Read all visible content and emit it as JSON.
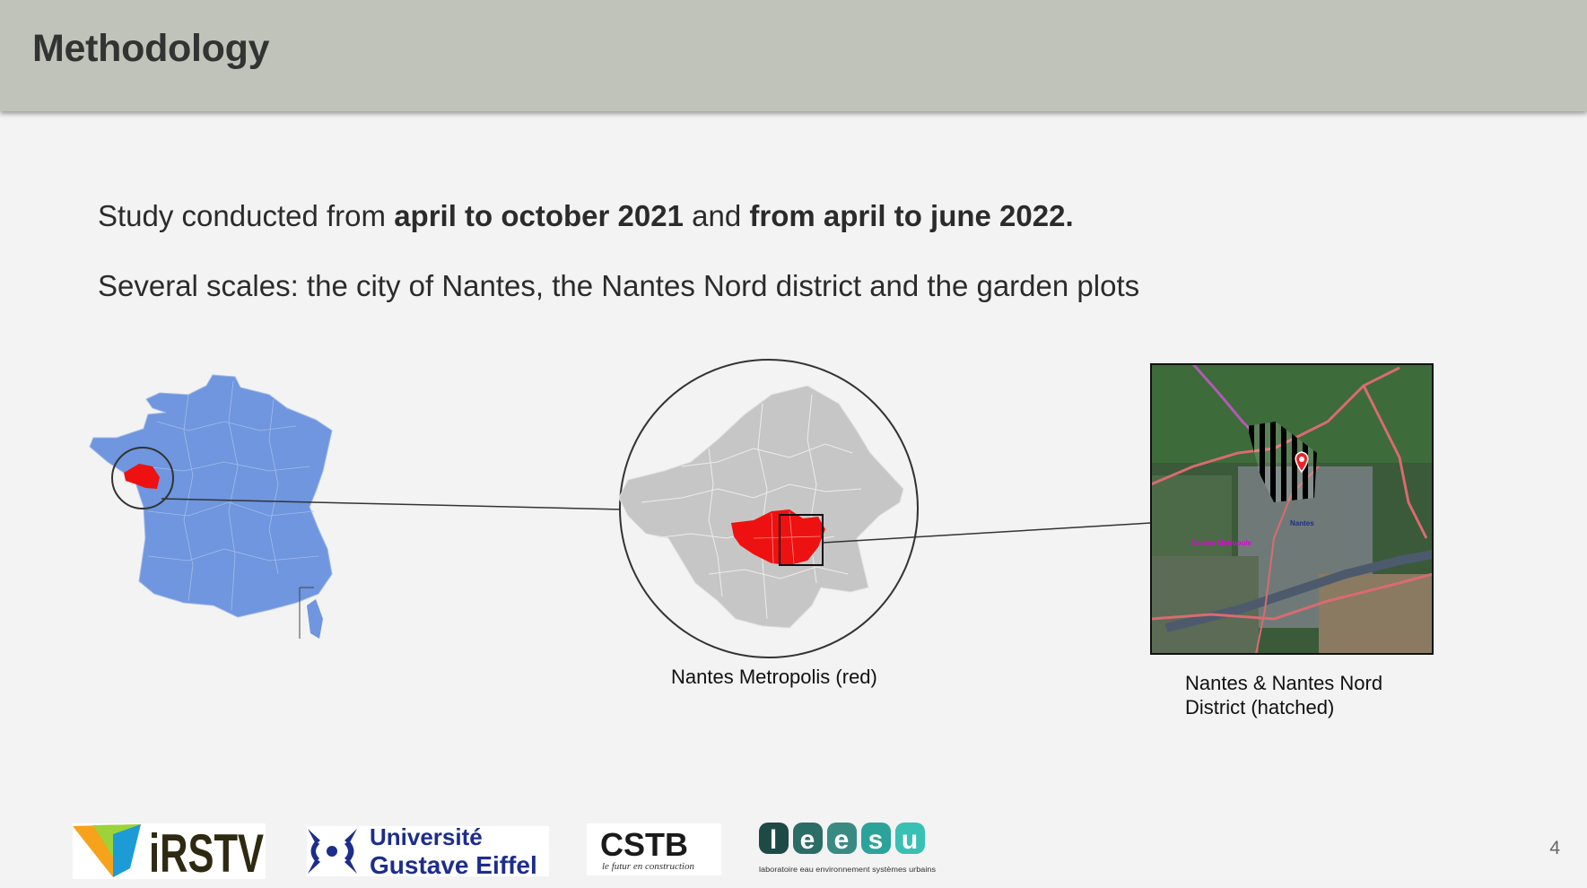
{
  "slide": {
    "title": "Methodology",
    "line1": {
      "prefix": "Study conducted from ",
      "bold1": "april to october 2021",
      "middle": " and ",
      "bold2": "from april to june 2022."
    },
    "line2": "Several scales: the city of Nantes, the Nantes Nord district and the garden plots",
    "page_number": "4"
  },
  "figures": {
    "metropolis_caption": "Nantes Metropolis (red)",
    "district_caption_line1": "Nantes & Nantes Nord",
    "district_caption_line2": "District (hatched)",
    "map_label_nantes": "Nantes",
    "map_label_metropole": "Nantes Métropole"
  },
  "logos": {
    "irstv": "iRSTV",
    "univ_line1": "Université",
    "univ_line2": "Gustave Eiffel",
    "cstb": "CSTB",
    "cstb_tagline": "le futur en construction",
    "leesu_letters": [
      "l",
      "e",
      "e",
      "s",
      "u"
    ],
    "leesu_tagline": "laboratoire eau environnement systèmes urbains"
  },
  "colors": {
    "header_bg": "#c0c3b9",
    "france_fill": "#6f96de",
    "highlight_red": "#ee1111",
    "metropolis_gray": "#c6c6c6",
    "leesu_teal": "#26a69a",
    "univ_blue": "#1d2d8c"
  }
}
